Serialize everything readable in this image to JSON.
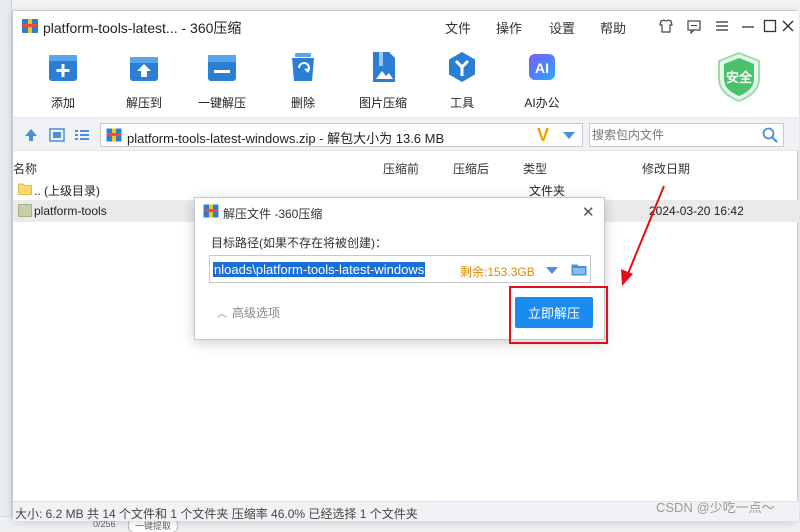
{
  "window": {
    "title": "platform-tools-latest... - 360压缩",
    "menu": [
      "文件",
      "操作",
      "设置",
      "帮助"
    ]
  },
  "toolbar": {
    "tools": [
      {
        "name": "add",
        "label": "添加"
      },
      {
        "name": "extract-to",
        "label": "解压到"
      },
      {
        "name": "one-click-extract",
        "label": "一键解压"
      },
      {
        "name": "delete",
        "label": "删除"
      },
      {
        "name": "image-compress",
        "label": "图片压缩"
      },
      {
        "name": "tools",
        "label": "工具"
      },
      {
        "name": "ai-office",
        "label": "AI办公"
      }
    ],
    "safe_label": "安全"
  },
  "address": {
    "path": "platform-tools-latest-windows.zip - 解包大小为 13.6 MB",
    "logo": "V",
    "search_placeholder": "搜索包内文件"
  },
  "list": {
    "columns": [
      "名称",
      "压缩前",
      "压缩后",
      "类型",
      "修改日期"
    ],
    "rows": [
      {
        "name": ".. (上级目录)",
        "type": "文件夹",
        "date": ""
      },
      {
        "name": "platform-tools",
        "type": "",
        "date": "2024-03-20 16:42"
      }
    ]
  },
  "status": {
    "text": "大小: 6.2 MB 共 14 个文件和 1 个文件夹 压缩率 46.0% 已经选择 1 个文件夹"
  },
  "watermark": "CSDN @少吃一点～",
  "background": {
    "bottom_text1": "0/256",
    "bottom_text2": "一键提取"
  },
  "dialog": {
    "title": "解压文件 -360压缩",
    "label": "目标路径(如果不存在将被创建)：",
    "path_value": "nloads\\platform-tools-latest-windows",
    "free_space": "剩余:153.3GB",
    "advanced": "高级选项",
    "confirm": "立即解压"
  },
  "colors": {
    "accent_blue": "#1a8cf0",
    "icon_blue": "#2a7fd4",
    "annotation_red": "#e0101a",
    "free_space_orange": "#e08a00",
    "safe_green": "#4ac26b"
  }
}
